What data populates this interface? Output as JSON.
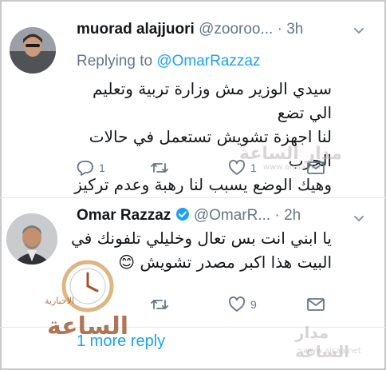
{
  "tweets": [
    {
      "display_name": "muorad alajjuori",
      "handle": "@zooroo...",
      "separator": "·",
      "time": "3h",
      "replying_prefix": "Replying to",
      "replying_handle": "@OmarRazzaz",
      "body_lines": [
        "سيدي الوزير مش وزارة تربية وتعليم الي تضع",
        "لنا اجهزة تشويش تستعمل في حالات الحرب",
        "وهيك الوضع يسبب لنا رهبة وعدم تركيز"
      ],
      "reply_count": "1",
      "retweet_count": "",
      "like_count": "1"
    },
    {
      "display_name": "Omar Razzaz",
      "verified": true,
      "handle": "@OmarR...",
      "separator": "·",
      "time": "2h",
      "body_lines": [
        "يا ابني انت بس تعال وخليلي تلفونك في",
        "البيت هذا اكبر مصدر تشويش 😊"
      ],
      "reply_count": "",
      "retweet_count": "",
      "like_count": "9"
    }
  ],
  "more_replies": "1 more reply",
  "watermarks": {
    "brand_arabic": "مدار الساعة",
    "brand_sub": "الاخبارية",
    "url": "www.alsaa.net"
  },
  "colors": {
    "accent": "#1da1f2",
    "secondary_text": "#657786",
    "primary_text": "#14171a",
    "verified": "#1da1f2"
  },
  "icons": [
    "chevron-down-icon",
    "reply-icon",
    "retweet-icon",
    "like-icon",
    "dm-icon",
    "verified-badge-icon"
  ]
}
